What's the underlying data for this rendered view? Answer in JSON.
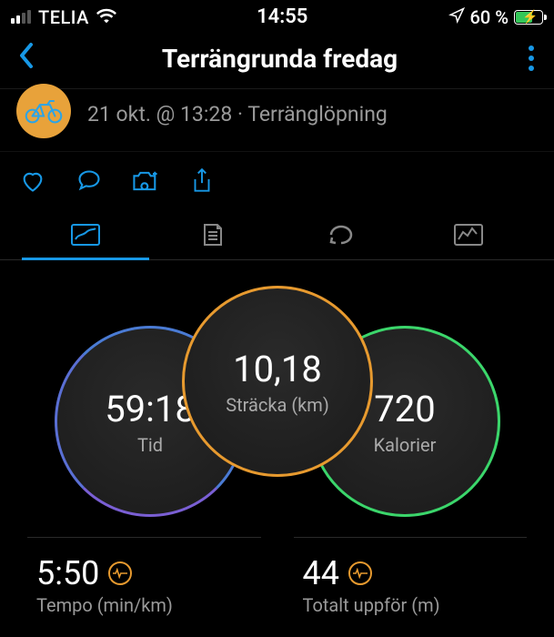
{
  "status": {
    "carrier": "TELIA",
    "time": "14:55",
    "battery_pct": "60 %"
  },
  "nav": {
    "title": "Terrängrunda fredag"
  },
  "meta": {
    "subtitle": "21 okt. @ 13:28 · Terränglöpning"
  },
  "metrics": {
    "distance": {
      "value": "10,18",
      "label": "Sträcka (km)"
    },
    "time": {
      "value": "59:18",
      "label": "Tid"
    },
    "calories": {
      "value": "720",
      "label": "Kalorier"
    }
  },
  "stats": {
    "pace": {
      "value": "5:50",
      "label": "Tempo (min/km)"
    },
    "ascent": {
      "value": "44",
      "label": "Totalt uppför (m)"
    }
  }
}
